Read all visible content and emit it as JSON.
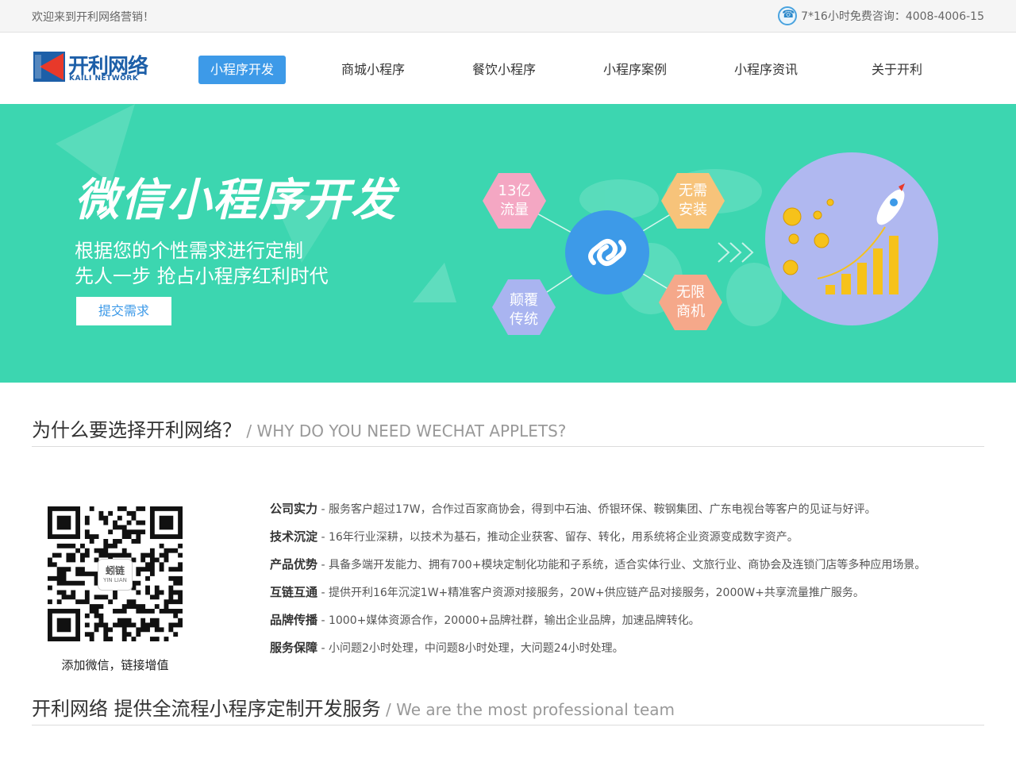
{
  "topbar": {
    "welcome": "欢迎来到开利网络营销！",
    "hotline": "7*16小时免费咨询：4008-4006-15",
    "hotline_icon": "phone-icon"
  },
  "logo": {
    "name": "开利网络",
    "sub": "KAILI NETWORK"
  },
  "nav": {
    "items": [
      {
        "label": "小程序开发",
        "active": true
      },
      {
        "label": "商城小程序",
        "active": false
      },
      {
        "label": "餐饮小程序",
        "active": false
      },
      {
        "label": "小程序案例",
        "active": false
      },
      {
        "label": "小程序资讯",
        "active": false
      },
      {
        "label": "关于开利",
        "active": false
      }
    ]
  },
  "banner": {
    "title": "微信小程序开发",
    "sub1": "根据您的个性需求进行定制",
    "sub2": "先人一步  抢占小程序红利时代",
    "cta": "提交需求",
    "hexes": [
      {
        "line1": "13亿",
        "line2": "流量",
        "color": "#f4a7c3"
      },
      {
        "line1": "无需",
        "line2": "安装",
        "color": "#f7c37a"
      },
      {
        "line1": "颠覆",
        "line2": "传统",
        "color": "#a9b4f0"
      },
      {
        "line1": "无限",
        "line2": "商机",
        "color": "#f5a88a"
      }
    ],
    "colors": {
      "background": "#3cd6b0",
      "center": "#3d9ae8",
      "circle": "#b0b8f0"
    }
  },
  "why": {
    "title_cn": "为什么要选择开利网络？",
    "title_en": " / WHY DO YOU NEED WECHAT APPLETS?"
  },
  "qr": {
    "center": "蚓链",
    "center_sub": "YIN LIAN",
    "caption": "添加微信，链接增值"
  },
  "features": [
    {
      "key": "公司实力",
      "text": " - 服务客户超过17W，合作过百家商协会，得到中石油、侨银环保、鞍钢集团、广东电视台等客户的见证与好评。"
    },
    {
      "key": "技术沉淀",
      "text": " - 16年行业深耕，以技术为基石，推动企业获客、留存、转化，用系统将企业资源变成数字资产。"
    },
    {
      "key": "产品优势",
      "text": " - 具备多端开发能力、拥有700+模块定制化功能和子系统，适合实体行业、文旅行业、商协会及连锁门店等多种应用场景。"
    },
    {
      "key": "互链互通",
      "text": " - 提供开利16年沉淀1W+精准客户资源对接服务，20W+供应链产品对接服务，2000W+共享流量推广服务。"
    },
    {
      "key": "品牌传播",
      "text": " - 1000+媒体资源合作，20000+品牌社群，输出企业品牌，加速品牌转化。"
    },
    {
      "key": "服务保障",
      "text": " - 小问题2小时处理，中问题8小时处理，大问题24小时处理。"
    }
  ],
  "team": {
    "title_cn": "开利网络 提供全流程小程序定制开发服务",
    "title_en": " / We are the most professional team"
  }
}
